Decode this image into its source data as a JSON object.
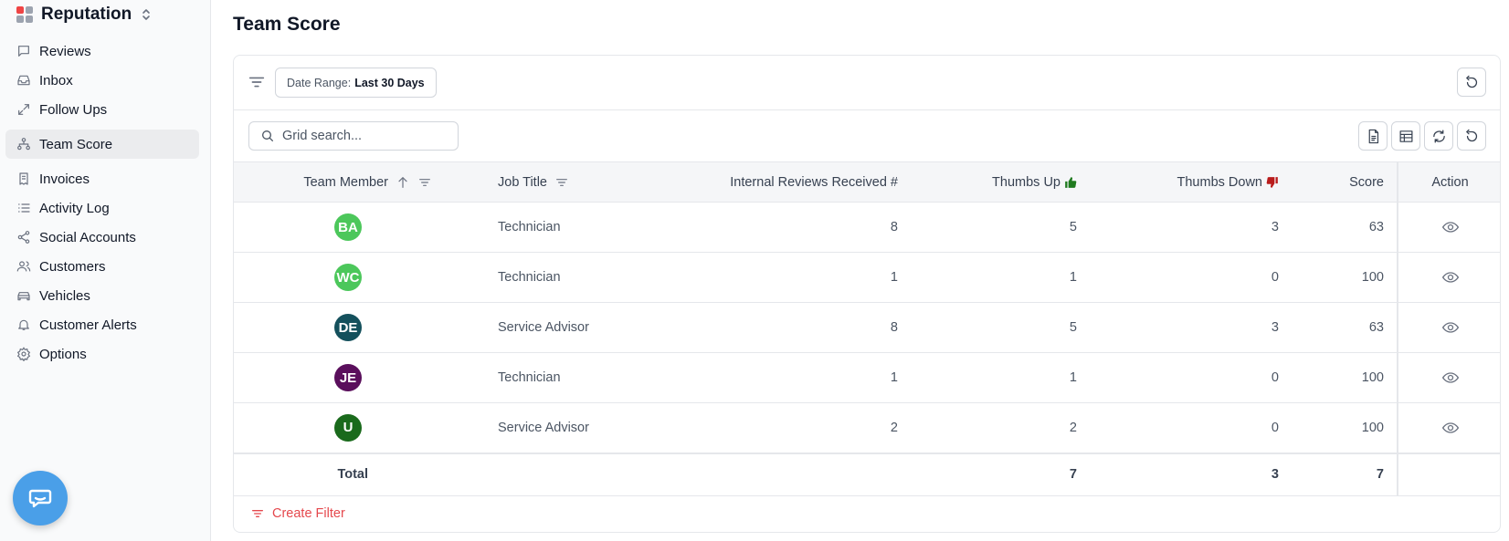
{
  "app": {
    "title": "Reputation"
  },
  "sidebar": {
    "items": [
      {
        "label": "Reviews",
        "icon": "message-square-icon"
      },
      {
        "label": "Inbox",
        "icon": "inbox-icon"
      },
      {
        "label": "Follow Ups",
        "icon": "follow-up-icon"
      },
      {
        "label": "Team Score",
        "icon": "team-structure-icon",
        "active": true
      },
      {
        "label": "Invoices",
        "icon": "receipt-icon"
      },
      {
        "label": "Activity Log",
        "icon": "list-icon"
      },
      {
        "label": "Social Accounts",
        "icon": "share-icon"
      },
      {
        "label": "Customers",
        "icon": "users-icon"
      },
      {
        "label": "Vehicles",
        "icon": "car-icon"
      },
      {
        "label": "Customer Alerts",
        "icon": "bell-icon"
      },
      {
        "label": "Options",
        "icon": "gear-icon"
      }
    ]
  },
  "page": {
    "title": "Team Score"
  },
  "filters": {
    "date_range_label": "Date Range:",
    "date_range_value": "Last 30 Days"
  },
  "search": {
    "placeholder": "Grid search..."
  },
  "table": {
    "columns": {
      "member": "Team Member",
      "job": "Job Title",
      "reviews": "Internal Reviews Received #",
      "up": "Thumbs Up",
      "down": "Thumbs Down",
      "score": "Score",
      "action": "Action"
    },
    "rows": [
      {
        "initials": "BA",
        "color": "#4cc75b",
        "job": "Technician",
        "reviews": "8",
        "up": "5",
        "down": "3",
        "score": "63"
      },
      {
        "initials": "WC",
        "color": "#4cc75b",
        "job": "Technician",
        "reviews": "1",
        "up": "1",
        "down": "0",
        "score": "100"
      },
      {
        "initials": "DE",
        "color": "#14505c",
        "job": "Service Advisor",
        "reviews": "8",
        "up": "5",
        "down": "3",
        "score": "63"
      },
      {
        "initials": "JE",
        "color": "#5a0f5c",
        "job": "Technician",
        "reviews": "1",
        "up": "1",
        "down": "0",
        "score": "100"
      },
      {
        "initials": "U",
        "color": "#1a6a1c",
        "job": "Service Advisor",
        "reviews": "2",
        "up": "2",
        "down": "0",
        "score": "100"
      }
    ],
    "total": {
      "label": "Total",
      "up": "7",
      "down": "3",
      "score": "7"
    }
  },
  "footer": {
    "create_filter": "Create Filter"
  },
  "colors": {
    "thumbs_up": "#1f7a1f",
    "thumbs_down": "#b91c1c",
    "accent_red": "#e5484d",
    "chat": "#4a9fe8"
  }
}
